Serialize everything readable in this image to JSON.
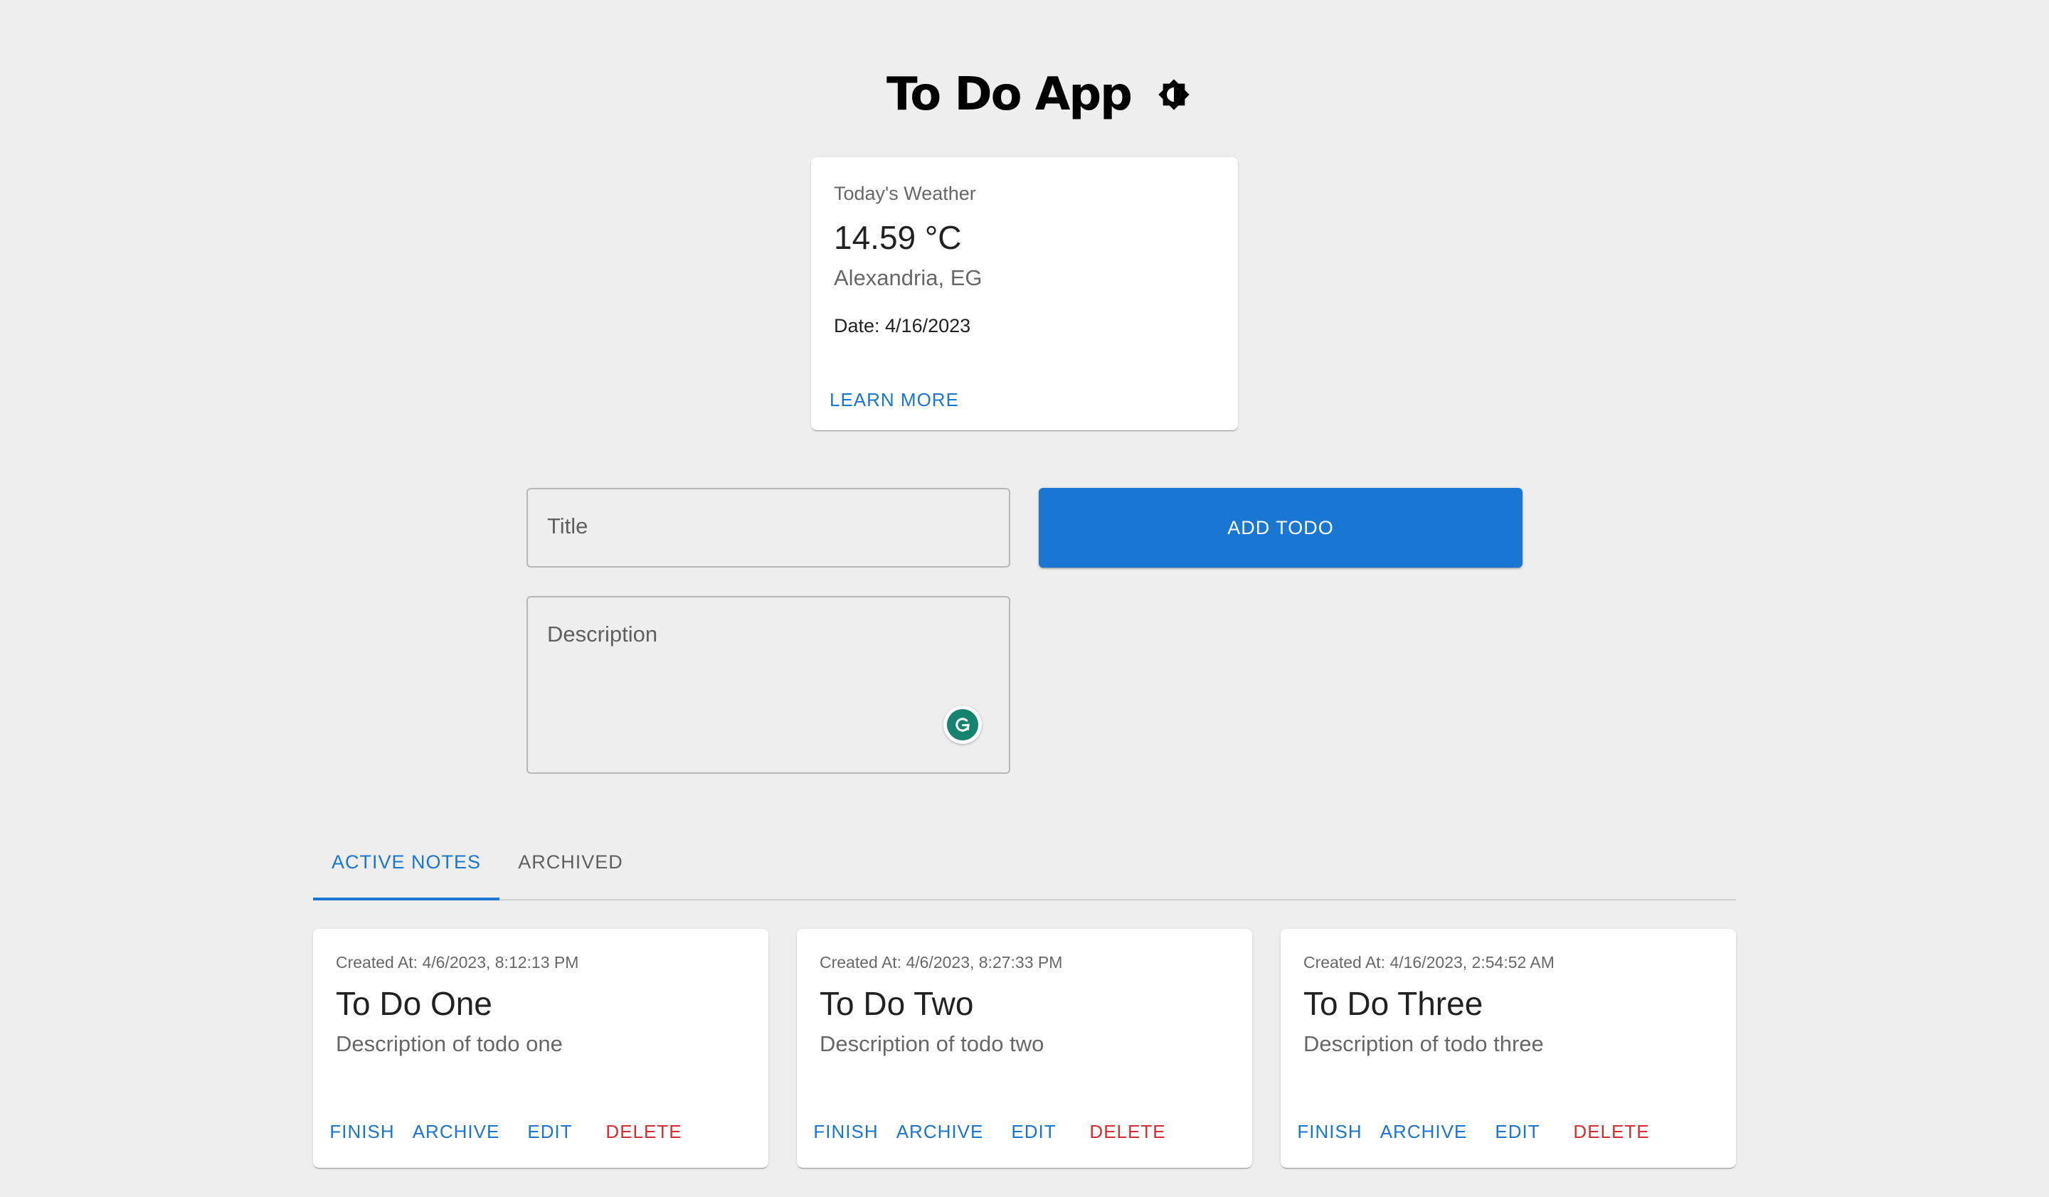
{
  "header": {
    "title": "To Do App",
    "theme_icon": "brightness-icon"
  },
  "weather": {
    "label": "Today's Weather",
    "temperature": "14.59 °C",
    "location": "Alexandria, EG",
    "date": "Date: 4/16/2023",
    "learn_more": "LEARN MORE"
  },
  "form": {
    "title_placeholder": "Title",
    "description_placeholder": "Description",
    "add_button": "ADD TODO",
    "grammarly_icon": "grammarly-icon"
  },
  "tabs": [
    {
      "label": "ACTIVE NOTES",
      "active": true
    },
    {
      "label": "ARCHIVED",
      "active": false
    }
  ],
  "notes": [
    {
      "created": "Created At: 4/6/2023, 8:12:13 PM",
      "title": "To Do One",
      "description": "Description of todo one",
      "actions": [
        "FINISH",
        "ARCHIVE",
        "EDIT",
        "DELETE"
      ]
    },
    {
      "created": "Created At: 4/6/2023, 8:27:33 PM",
      "title": "To Do Two",
      "description": "Description of todo two",
      "actions": [
        "FINISH",
        "ARCHIVE",
        "EDIT",
        "DELETE"
      ]
    },
    {
      "created": "Created At: 4/16/2023, 2:54:52 AM",
      "title": "To Do Three",
      "description": "Description of todo three",
      "actions": [
        "FINISH",
        "ARCHIVE",
        "EDIT",
        "DELETE"
      ]
    }
  ],
  "colors": {
    "background": "#eeeeee",
    "primary": "#1976d2",
    "danger": "#d32f2f",
    "grammarly": "#15846f"
  }
}
